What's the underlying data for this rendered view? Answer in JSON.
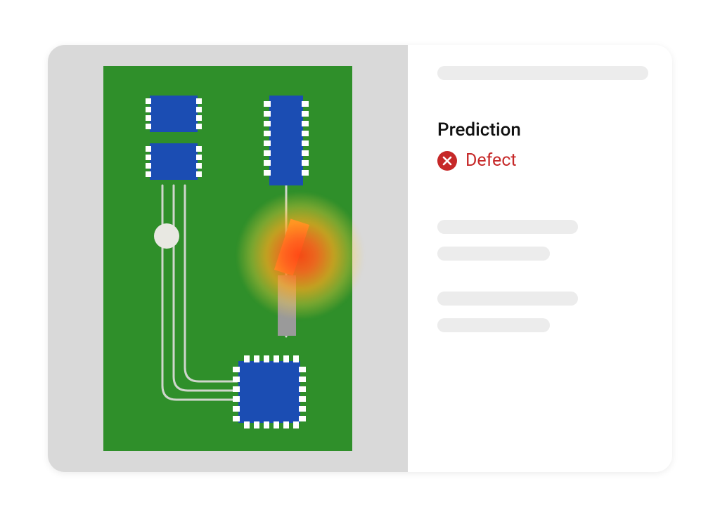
{
  "panel": {
    "section_title": "Prediction",
    "prediction_label": "Defect",
    "prediction_status": "defect",
    "status_color": "#c62828"
  },
  "image": {
    "kind": "pcb-board",
    "defect_highlight": true
  }
}
